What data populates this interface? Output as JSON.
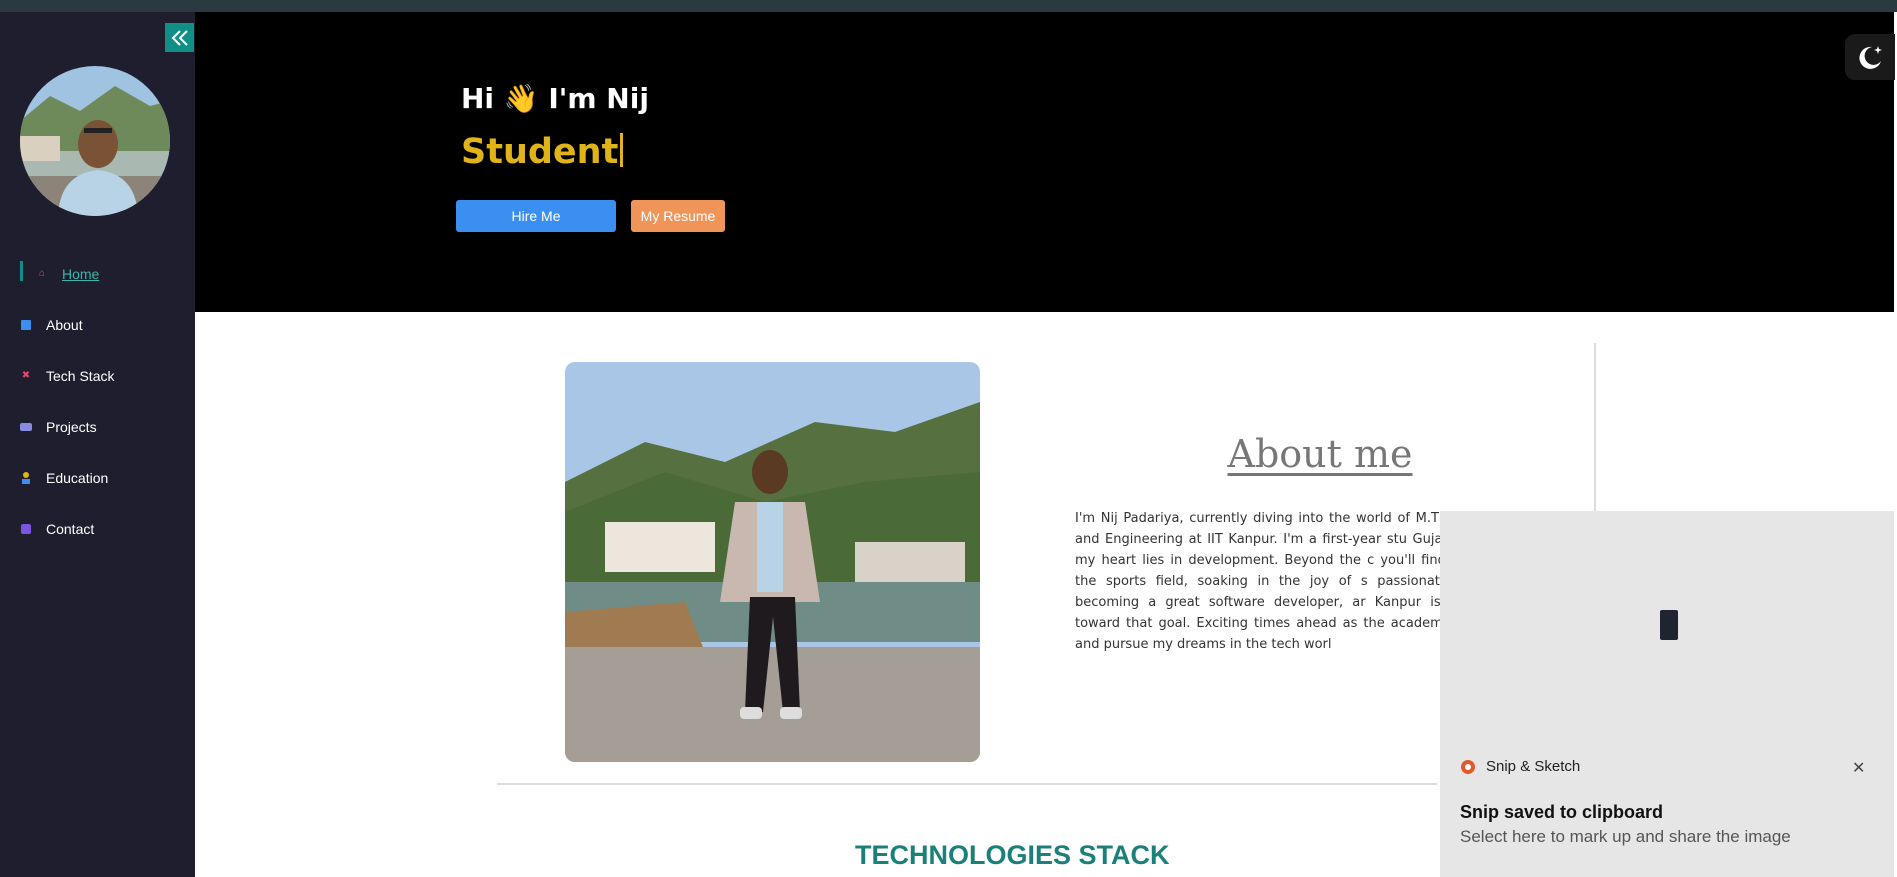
{
  "sidebar": {
    "items": [
      {
        "label": "Home",
        "icon": "home-icon",
        "active": true,
        "color": "#e8456b"
      },
      {
        "label": "About",
        "icon": "info-icon",
        "color": "#3b8ff0"
      },
      {
        "label": "Tech Stack",
        "icon": "tech-icon",
        "color": "#e8456b"
      },
      {
        "label": "Projects",
        "icon": "projects-icon",
        "color": "#8a8ae0"
      },
      {
        "label": "Education",
        "icon": "education-icon",
        "color": "#e0b319"
      },
      {
        "label": "Contact",
        "icon": "contact-icon",
        "color": "#7a55e0"
      }
    ]
  },
  "hero": {
    "greeting": "Hi 👋 I'm Nij",
    "role": "Student",
    "hire_label": "Hire Me",
    "resume_label": "My Resume"
  },
  "about": {
    "title": "About me",
    "text": "I'm Nij Padariya, currently diving into the world of M.T Science and Engineering at IIT Kanpur. I'm a first-year stu Gujarat, and my heart lies in development. Beyond the c you'll find me on the sports field, soaking in the joy of s passionate about becoming a great software developer, ar Kanpur is a step toward that goal. Exciting times ahead as the academic maze and pursue my dreams in the tech worl"
  },
  "tech": {
    "title": "TECHNOLOGIES STACK"
  },
  "toast": {
    "app": "Snip & Sketch",
    "title": "Snip saved to clipboard",
    "subtitle": "Select here to mark up and share the image"
  },
  "colors": {
    "accent": "#0f8f86",
    "hire": "#3b8ff0",
    "resume": "#f0955a",
    "role": "#e0b319"
  }
}
